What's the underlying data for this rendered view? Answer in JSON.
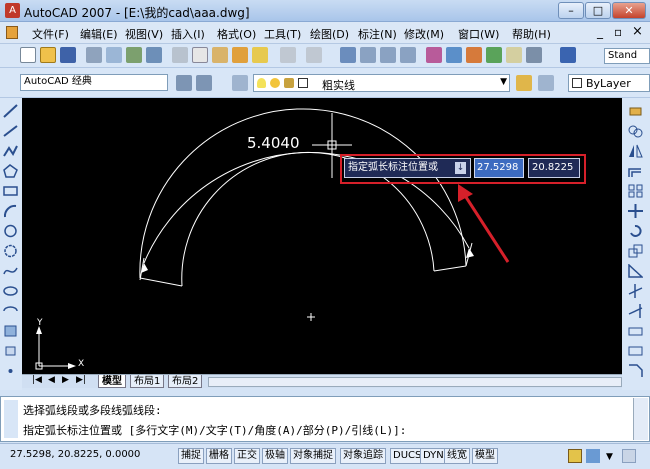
{
  "window": {
    "title": "AutoCAD 2007 - [E:\\我的cad\\aaa.dwg]",
    "minimize_glyph": "–",
    "maximize_glyph": "□",
    "close_glyph": "✕"
  },
  "menu": {
    "items": [
      "文件(F)",
      "编辑(E)",
      "视图(V)",
      "插入(I)",
      "格式(O)",
      "工具(T)",
      "绘图(D)",
      "标注(N)",
      "修改(M)",
      "窗口(W)",
      "帮助(H)"
    ],
    "doc_minimize": "_",
    "doc_restore": "▫",
    "doc_close": "×"
  },
  "toolbar": {
    "workspace": "AutoCAD 经典",
    "layer": "粗实线",
    "color": "ByLayer",
    "style": "Stand"
  },
  "drawing": {
    "dimension_text": "5.4040",
    "ucs_y": "Y",
    "ucs_x": "X"
  },
  "dynamic_input": {
    "prompt": "指定弧长标注位置或",
    "arrow_glyph": "↓",
    "value1": "27.5298",
    "value2": "20.8225"
  },
  "layout_tabs": [
    "模型",
    "布局1",
    "布局2"
  ],
  "command": {
    "line1": "选择弧线段或多段线弧线段:",
    "line2": "指定弧长标注位置或 [多行文字(M)/文字(T)/角度(A)/部分(P)/引线(L)]:"
  },
  "status": {
    "coords": "27.5298, 20.8225, 0.0000",
    "buttons": [
      "捕捉",
      "栅格",
      "正交",
      "极轴",
      "对象捕捉",
      "对象追踪",
      "DUCS",
      "DYN",
      "线宽",
      "模型"
    ]
  },
  "colors": {
    "highlight": "#d6202a",
    "canvas": "#000000",
    "drawing_lines": "#ffffff"
  }
}
